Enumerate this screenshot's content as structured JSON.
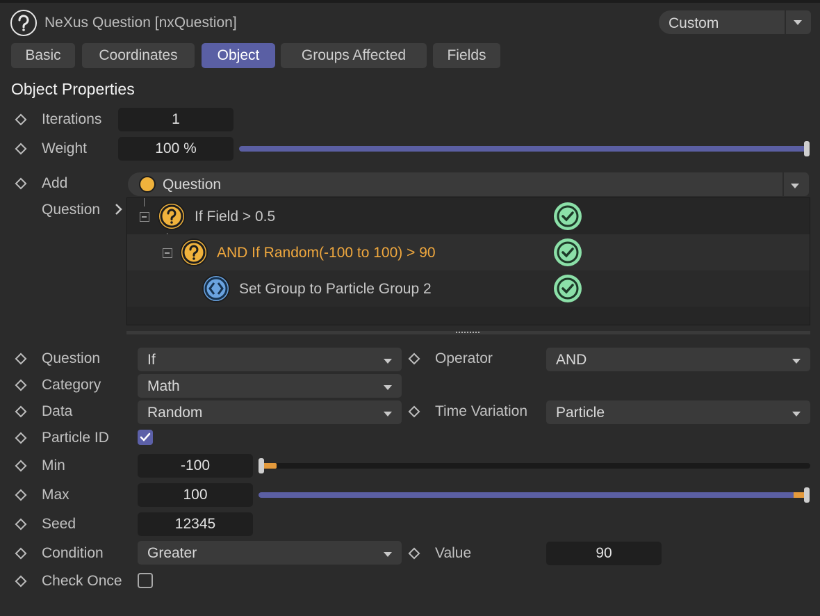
{
  "header": {
    "title": "NeXus Question [nxQuestion]",
    "preset": "Custom",
    "logo_icon": "question-circle-icon"
  },
  "tabs": [
    {
      "label": "Basic",
      "active": false
    },
    {
      "label": "Coordinates",
      "active": false
    },
    {
      "label": "Object",
      "active": true
    },
    {
      "label": "Groups Affected",
      "active": false
    },
    {
      "label": "Fields",
      "active": false
    }
  ],
  "section_title": "Object Properties",
  "fields": {
    "iterations": {
      "label": "Iterations",
      "value": "1"
    },
    "weight": {
      "label": "Weight",
      "value": "100 %",
      "slider_fraction": 1.0
    },
    "add": {
      "label": "Add",
      "value": "Question"
    },
    "question_list_label": "Question",
    "question": {
      "label": "Question",
      "value": "If"
    },
    "operator": {
      "label": "Operator",
      "value": "AND"
    },
    "category": {
      "label": "Category",
      "value": "Math"
    },
    "data": {
      "label": "Data",
      "value": "Random"
    },
    "time_variation": {
      "label": "Time Variation",
      "value": "Particle"
    },
    "particle_id": {
      "label": "Particle ID",
      "checked": true
    },
    "min": {
      "label": "Min",
      "value": "-100",
      "slider_fraction": 0.0
    },
    "max": {
      "label": "Max",
      "value": "100",
      "slider_fraction": 1.0
    },
    "seed": {
      "label": "Seed",
      "value": "12345"
    },
    "condition": {
      "label": "Condition",
      "value": "Greater"
    },
    "value": {
      "label": "Value",
      "value": "90"
    },
    "check_once": {
      "label": "Check Once",
      "checked": false
    }
  },
  "tree": [
    {
      "label": "If Field > 0.5",
      "depth": 0,
      "icon": "question-icon",
      "enabled": true,
      "highlight": false
    },
    {
      "label": "AND If Random(-100 to 100) > 90",
      "depth": 1,
      "icon": "question-icon",
      "enabled": true,
      "highlight": true
    },
    {
      "label": "Set Group to Particle Group 2",
      "depth": 2,
      "icon": "action-icon",
      "enabled": true,
      "highlight": false
    }
  ],
  "colors": {
    "accent": "#5a5fa4",
    "highlight_text": "#f0a83e",
    "question_icon": "#f0b23c",
    "action_icon": "#6aa3e0",
    "check": "#8be0a8"
  }
}
